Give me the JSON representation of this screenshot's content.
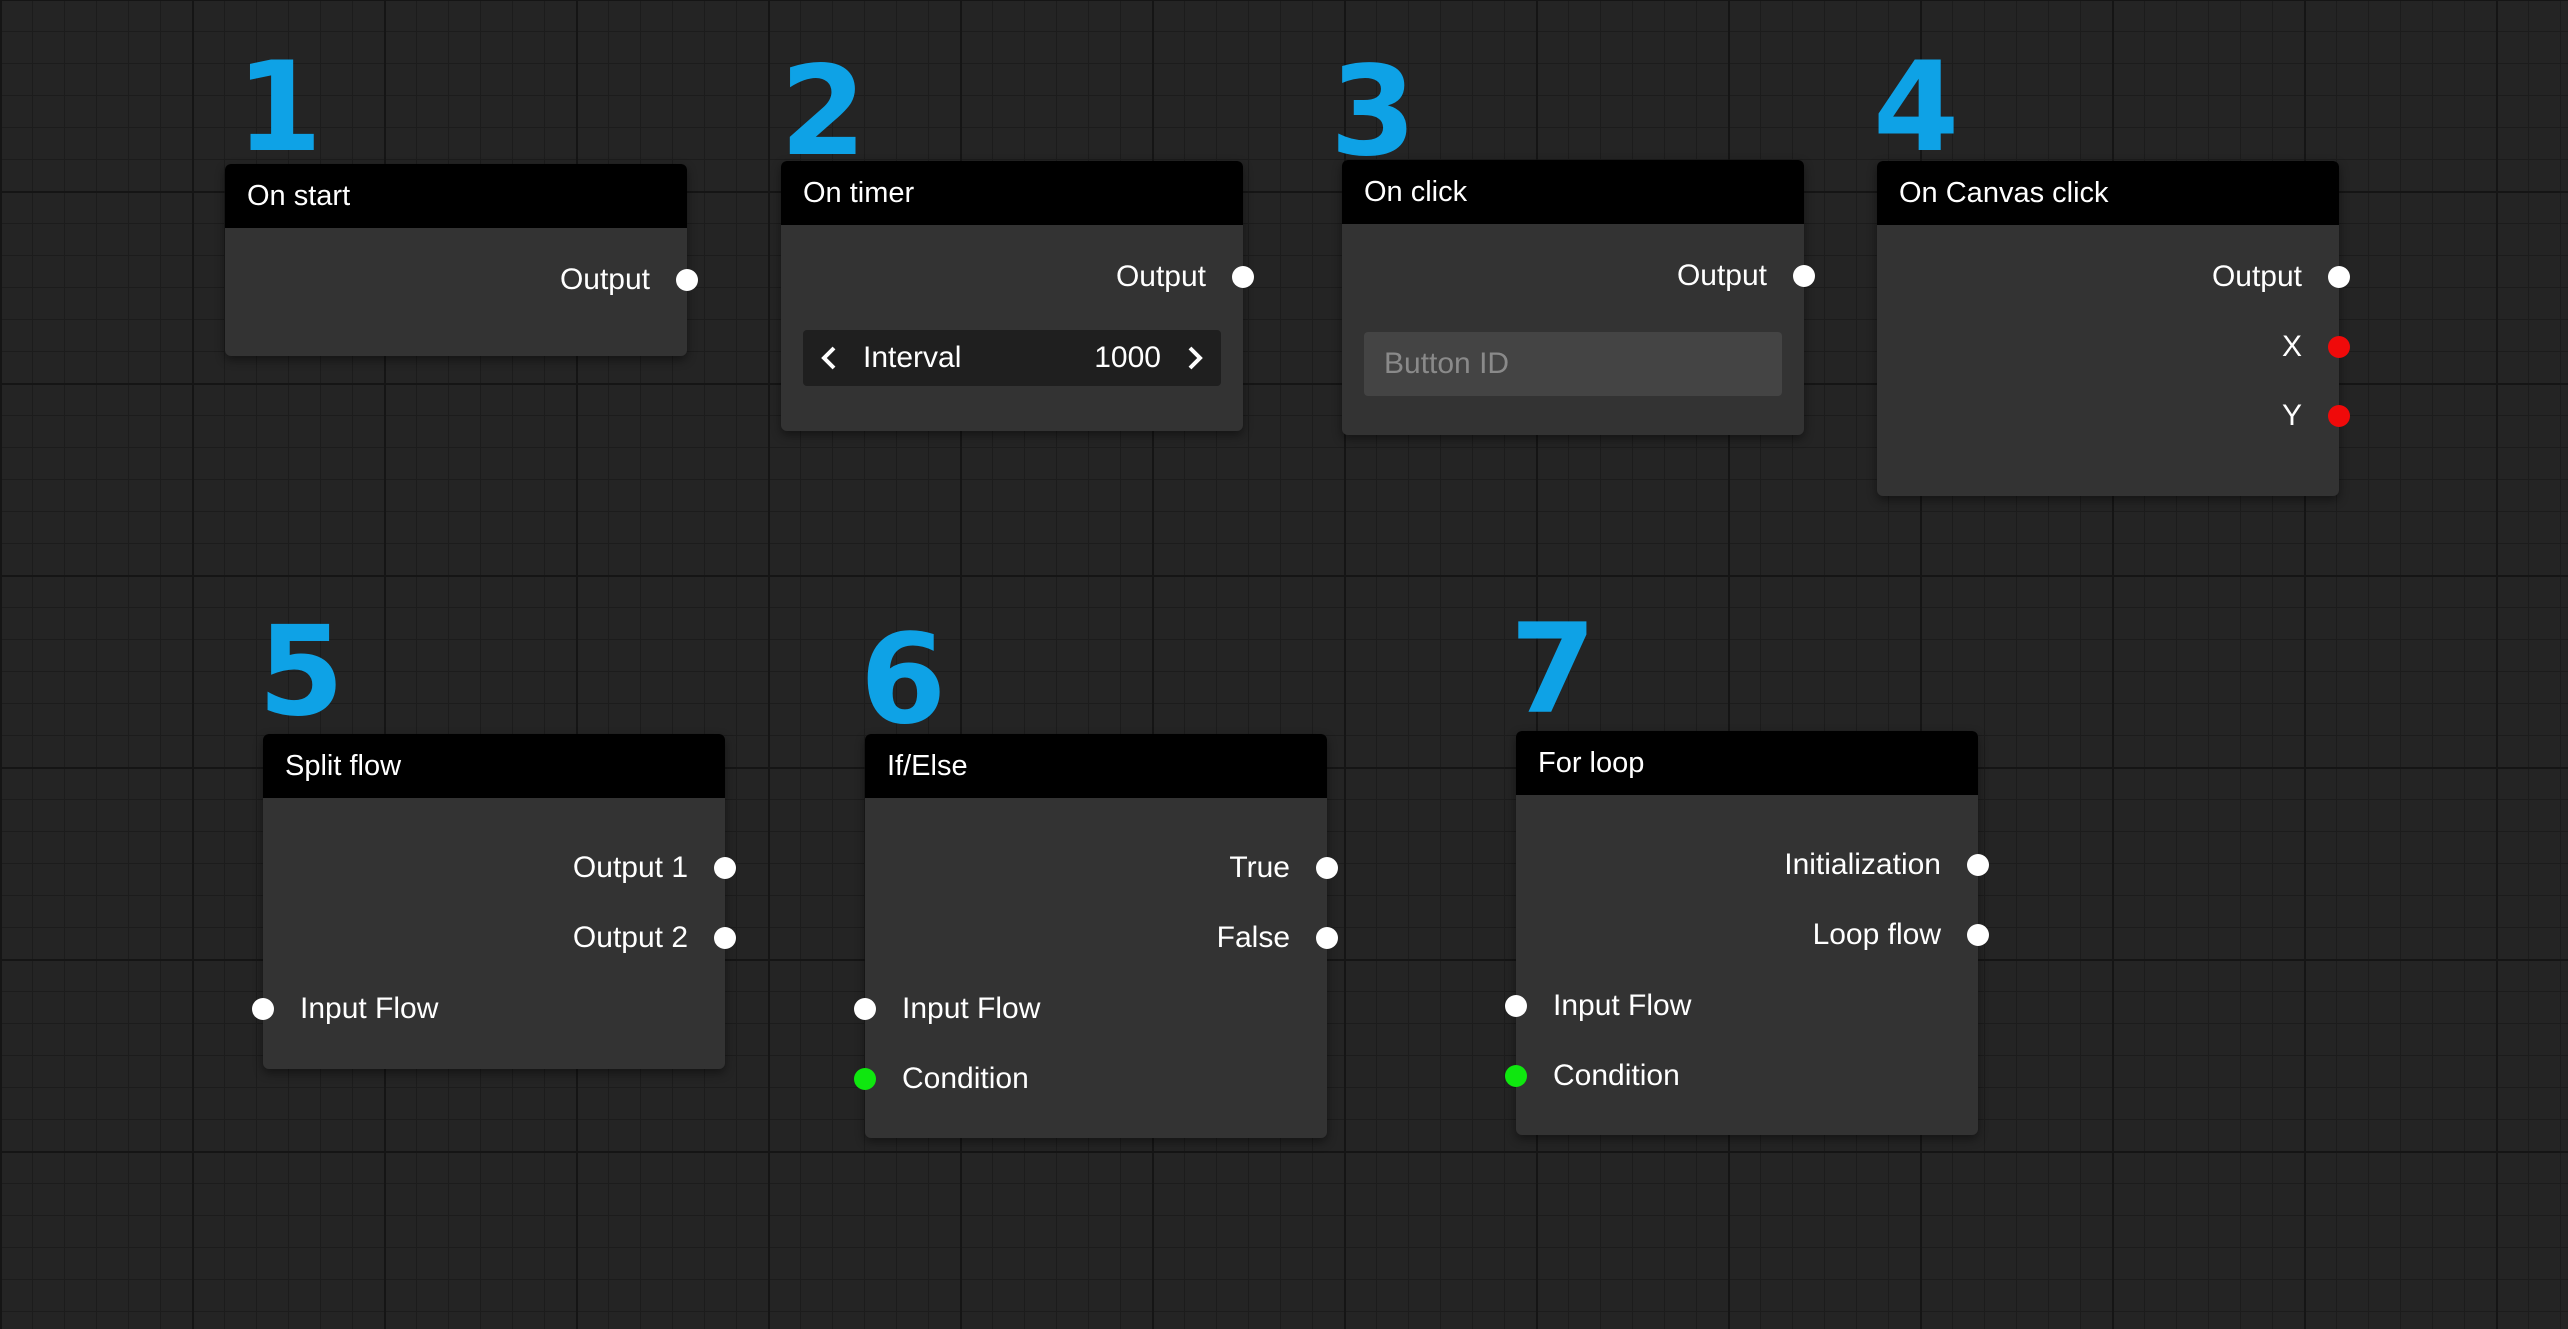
{
  "accent_color": "#0ea2e6",
  "port_colors": {
    "flow": "#ffffff",
    "number": "#f00a0a",
    "boolean": "#0fe70f"
  },
  "nodes": [
    {
      "number": "1",
      "title": "On start",
      "outputs": [
        {
          "label": "Output",
          "type": "flow"
        }
      ]
    },
    {
      "number": "2",
      "title": "On timer",
      "outputs": [
        {
          "label": "Output",
          "type": "flow"
        }
      ],
      "stepper": {
        "label": "Interval",
        "value": "1000"
      }
    },
    {
      "number": "3",
      "title": "On click",
      "outputs": [
        {
          "label": "Output",
          "type": "flow"
        }
      ],
      "input_field": {
        "placeholder": "Button ID",
        "value": ""
      }
    },
    {
      "number": "4",
      "title": "On Canvas click",
      "outputs": [
        {
          "label": "Output",
          "type": "flow"
        },
        {
          "label": "X",
          "type": "number"
        },
        {
          "label": "Y",
          "type": "number"
        }
      ]
    },
    {
      "number": "5",
      "title": "Split flow",
      "outputs": [
        {
          "label": "Output 1",
          "type": "flow"
        },
        {
          "label": "Output 2",
          "type": "flow"
        }
      ],
      "inputs": [
        {
          "label": "Input Flow",
          "type": "flow"
        }
      ]
    },
    {
      "number": "6",
      "title": "If/Else",
      "outputs": [
        {
          "label": "True",
          "type": "flow"
        },
        {
          "label": "False",
          "type": "flow"
        }
      ],
      "inputs": [
        {
          "label": "Input Flow",
          "type": "flow"
        },
        {
          "label": "Condition",
          "type": "boolean"
        }
      ]
    },
    {
      "number": "7",
      "title": "For loop",
      "outputs": [
        {
          "label": "Initialization",
          "type": "flow"
        },
        {
          "label": "Loop flow",
          "type": "flow"
        }
      ],
      "inputs": [
        {
          "label": "Input Flow",
          "type": "flow"
        },
        {
          "label": "Condition",
          "type": "boolean"
        }
      ]
    }
  ]
}
